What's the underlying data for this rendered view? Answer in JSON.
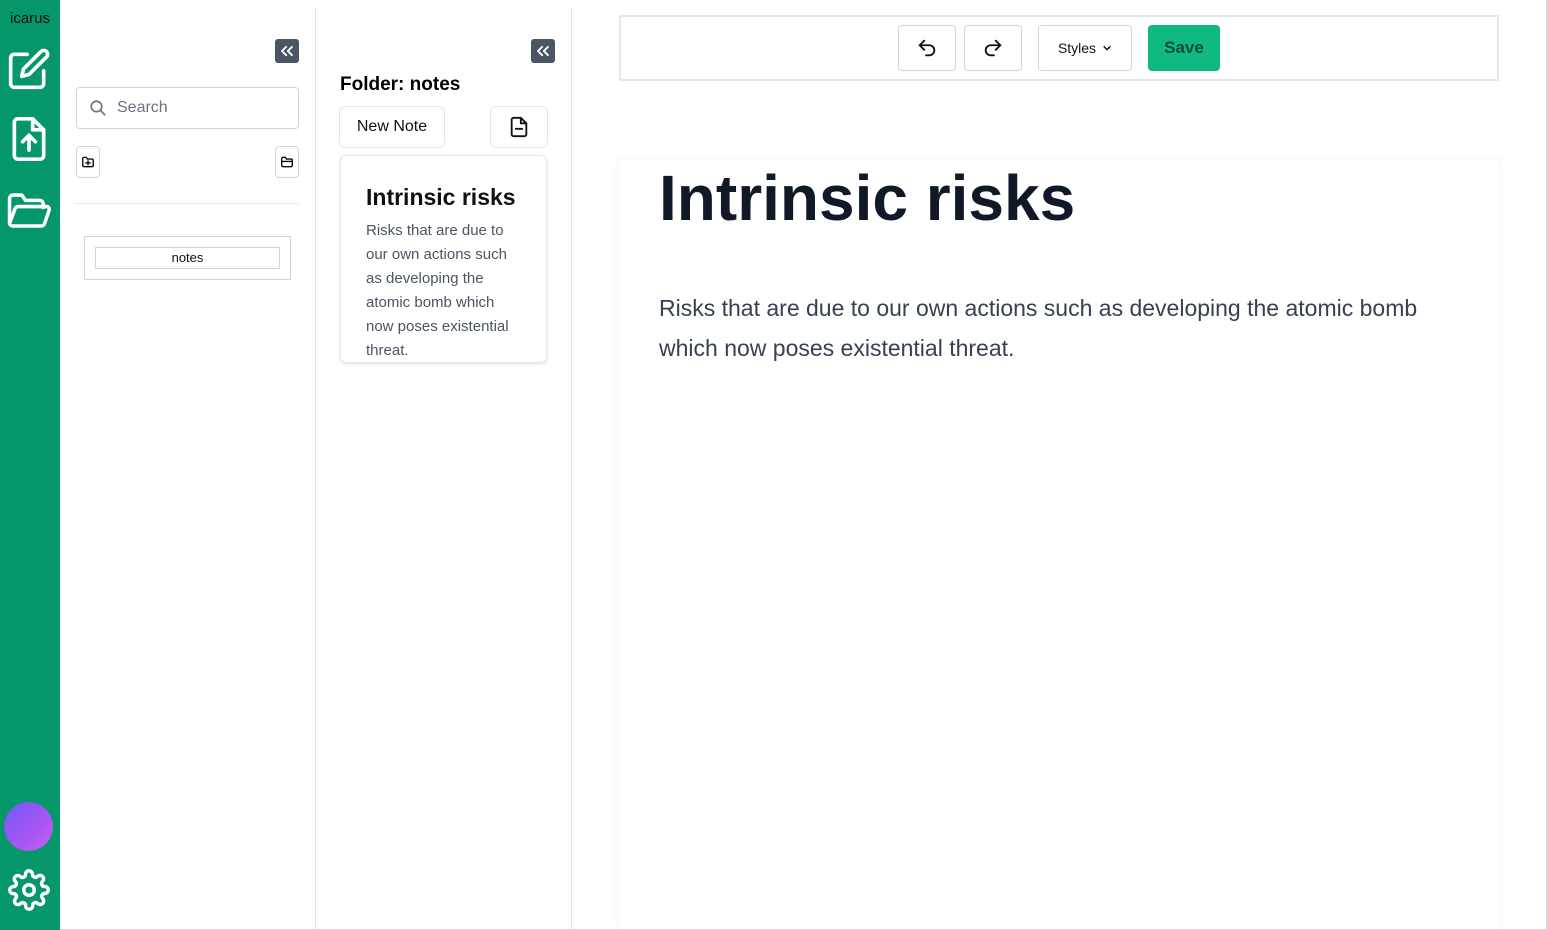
{
  "app": {
    "brand": "icarus"
  },
  "rail": {
    "items": [
      {
        "icon": "edit-icon"
      },
      {
        "icon": "file-upload-icon"
      },
      {
        "icon": "folder-open-icon"
      }
    ],
    "settings_icon": "gear-icon",
    "avatar_colors": [
      "#6d5bf0",
      "#c064e8"
    ]
  },
  "folders_pane": {
    "search": {
      "placeholder": "Search",
      "value": ""
    },
    "folders": [
      {
        "label": "notes"
      }
    ]
  },
  "notes_pane": {
    "title": "Folder: notes",
    "new_note_label": "New Note",
    "notes": [
      {
        "title": "Intrinsic risks",
        "preview": "Risks that are due to our own actions such as developing the atomic bomb which now poses existential threat."
      }
    ]
  },
  "editor": {
    "toolbar": {
      "styles_label": "Styles",
      "save_label": "Save"
    },
    "heading": "Intrinsic risks",
    "body": "Risks that are due to our own actions such as developing the atomic bomb which now poses existential threat."
  },
  "colors": {
    "accent": "#059669",
    "save": "#10b981"
  }
}
